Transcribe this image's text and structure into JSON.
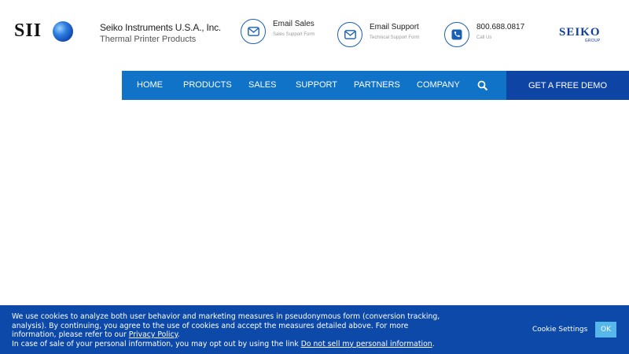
{
  "header": {
    "logo_text": "SII",
    "company_name": "Seiko Instruments U.S.A., Inc.",
    "company_sub": "Thermal Printer Products",
    "contacts": [
      {
        "title": "Email Sales",
        "sub": "Sales Support Form",
        "icon": "envelope-icon"
      },
      {
        "title": "Email Support",
        "sub": "Technical Support Form",
        "icon": "envelope-icon"
      },
      {
        "title": "800.688.0817",
        "sub": "Call Us",
        "icon": "phone-icon"
      }
    ],
    "seiko_logo": "SEIKO",
    "seiko_group": "GROUP"
  },
  "nav": {
    "items": [
      "HOME",
      "PRODUCTS",
      "SALES",
      "SUPPORT",
      "PARTNERS",
      "COMPANY"
    ],
    "search_icon": "search-icon",
    "demo_label": "GET A FREE DEMO"
  },
  "cookie": {
    "text_1": "We use cookies to analyze both user behavior and marketing measures in pseudonymous form (conversion tracking, analysis). By continuing, you agree to the use of cookies and accept the measures detailed above. For more information, please refer to our ",
    "privacy_link": "Privacy Policy",
    "text_2": ".",
    "text_3": "In case of sale of your personal information, you may opt out by using the link ",
    "opt_out_link": "Do not sell my personal information",
    "text_4": ".",
    "settings_label": "Cookie Settings",
    "ok_label": "OK"
  },
  "colors": {
    "nav_blue": "#1173c7",
    "demo_blue": "#0e45a5",
    "cookie_blue": "#0d49a9",
    "ok_button": "#55b7ea",
    "brand_navy": "#0f3e9e"
  }
}
